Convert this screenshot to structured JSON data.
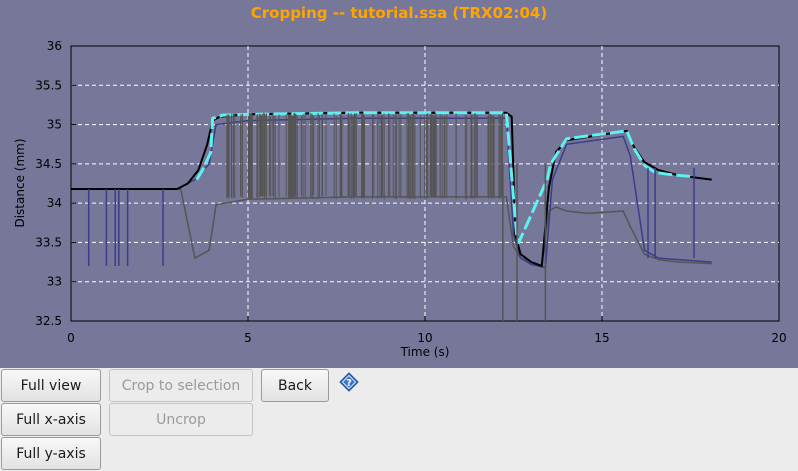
{
  "window_title": "Cropping -- tutorial.ssa (TRX02:04)",
  "buttons": {
    "full_view": "Full view",
    "full_x_axis": "Full x-axis",
    "full_y_axis": "Full y-axis",
    "crop_to_selection": "Crop to selection",
    "uncrop": "Uncrop",
    "back": "Back"
  },
  "help_icon": "help-icon",
  "colors": {
    "plot_background": "#777799",
    "title": "#ffa500",
    "trace_black": "#000000",
    "trace_gray": "#555555",
    "trace_blue": "#3c3c8c",
    "trace_cyan": "#5ff0f0"
  },
  "chart_data": {
    "type": "line",
    "title": "Cropping -- tutorial.ssa (TRX02:04)",
    "xlabel": "Time (s)",
    "ylabel": "Distance (mm)",
    "xlim": [
      0,
      20
    ],
    "ylim": [
      32.5,
      36
    ],
    "xticks": [
      "0",
      "5",
      "10",
      "15",
      "20"
    ],
    "yticks": [
      "32.5",
      "33",
      "33.5",
      "34",
      "34.5",
      "35",
      "35.5",
      "36"
    ],
    "grid": true,
    "series": [
      {
        "color": "#000000",
        "x": [
          0,
          3.0,
          3.3,
          3.6,
          3.85,
          4.0,
          4.2,
          5,
          8,
          12.3,
          12.45,
          12.55,
          12.7,
          13.0,
          13.3,
          13.5,
          13.7,
          14.0,
          15.7,
          15.9,
          16.2,
          16.6,
          17.2,
          18.1
        ],
        "y": [
          34.18,
          34.18,
          34.25,
          34.42,
          34.75,
          35.05,
          35.1,
          35.13,
          35.15,
          35.15,
          35.1,
          33.6,
          33.35,
          33.25,
          33.2,
          34.2,
          34.65,
          34.8,
          34.92,
          34.72,
          34.52,
          34.42,
          34.35,
          34.3
        ]
      },
      {
        "color": "#555555",
        "x": [
          0,
          3.1,
          3.5,
          3.9,
          4.1,
          5,
          8,
          12.3,
          12.5,
          12.7,
          13.0,
          13.3,
          13.5,
          13.7,
          14.0,
          14.6,
          15.6,
          15.8,
          16.2,
          16.6,
          17.2,
          18.1
        ],
        "y": [
          34.18,
          34.18,
          33.3,
          33.4,
          33.98,
          34.05,
          34.08,
          34.08,
          33.45,
          33.3,
          33.25,
          33.2,
          33.9,
          33.95,
          33.9,
          33.87,
          33.9,
          33.7,
          33.35,
          33.28,
          33.25,
          33.23
        ]
      },
      {
        "color": "#3c3c8c",
        "x": [
          0,
          3.0,
          3.5,
          3.9,
          4.1,
          5,
          8,
          12.3,
          12.5,
          12.7,
          13.0,
          13.4,
          13.6,
          14.0,
          15.6,
          15.8,
          16.2,
          16.6,
          17.2,
          18.1
        ],
        "y": [
          34.18,
          34.18,
          34.3,
          34.5,
          35.0,
          35.05,
          35.08,
          35.08,
          33.6,
          33.3,
          33.22,
          33.18,
          34.3,
          34.75,
          34.85,
          34.6,
          33.4,
          33.3,
          33.28,
          33.25
        ]
      },
      {
        "color": "#5ff0f0",
        "x": [
          3.55,
          3.75,
          3.95,
          4.0,
          4.3,
          5,
          8,
          12.3,
          12.55,
          12.6,
          12.65,
          13.45,
          13.55,
          14.0,
          15.7,
          15.9,
          16.2,
          16.5,
          17.0,
          17.5
        ],
        "y": [
          34.3,
          34.45,
          34.65,
          35.08,
          35.12,
          35.13,
          35.15,
          35.15,
          33.8,
          33.55,
          33.5,
          34.3,
          34.5,
          34.82,
          34.92,
          34.7,
          34.48,
          34.39,
          34.36,
          34.34
        ]
      }
    ]
  }
}
